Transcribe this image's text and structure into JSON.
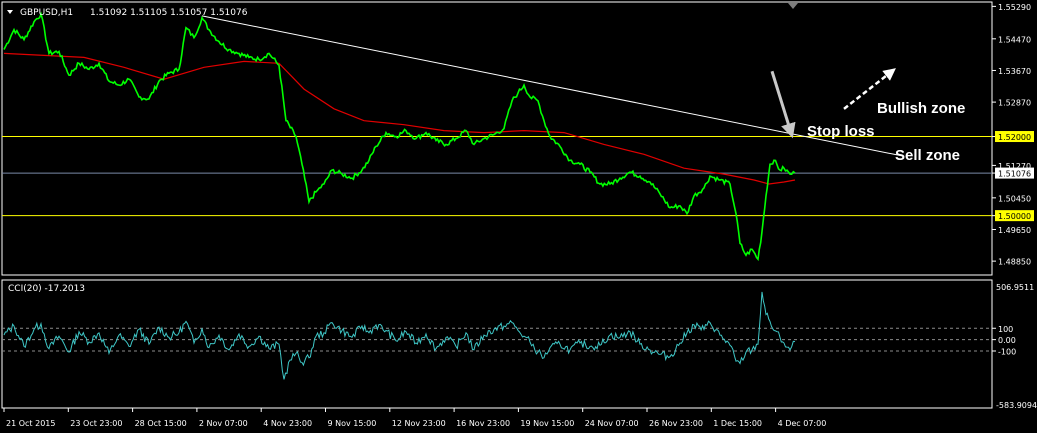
{
  "header": {
    "symbol": "GBPUSD,H1",
    "quote": "1.51092 1.51105 1.51057 1.51076",
    "menu_icon": "triangle-down-icon"
  },
  "cci": {
    "label": "CCI(20) -17.2013",
    "max_label": "506.9511",
    "min_label": "-583.9094",
    "levels": [
      100,
      0,
      -100
    ],
    "level_labels": [
      "100",
      "0.00",
      "-100"
    ],
    "color": "#3fc7c7"
  },
  "annotations": {
    "bullish": "Bullish zone",
    "stop": "Stop loss",
    "sell": "Sell zone"
  },
  "colors": {
    "background": "#000000",
    "price": "#00ff00",
    "ma": "#e00000",
    "yellow_level": "#ffff00",
    "current_line": "#7a8aa8",
    "trendline": "#ffffff",
    "axis": "#ffffff"
  },
  "chart_data": [
    {
      "type": "line",
      "title": "GBPUSD,H1",
      "ylim": [
        1.4855,
        1.5535
      ],
      "y_ticks": [
        "1.55290",
        "1.54470",
        "1.53670",
        "1.52870",
        "1.52000",
        "1.51270",
        "1.51076",
        "1.50450",
        "1.50000",
        "1.49650",
        "1.48850"
      ],
      "horizontal_levels": [
        1.52,
        1.5
      ],
      "current_price": 1.51076,
      "x": [
        "21 Oct 2015",
        "23 Oct 23:00",
        "28 Oct 15:00",
        "2 Nov 07:00",
        "4 Nov 23:00",
        "9 Nov 15:00",
        "12 Nov 23:00",
        "16 Nov 23:00",
        "19 Nov 15:00",
        "24 Nov 07:00",
        "26 Nov 23:00",
        "1 Dec 15:00",
        "4 Dec 07:00"
      ],
      "series": [
        {
          "kind": "price",
          "values": [
            [
              0,
              1.542
            ],
            [
              10,
              1.547
            ],
            [
              20,
              1.5445
            ],
            [
              30,
              1.549
            ],
            [
              37,
              1.551
            ],
            [
              45,
              1.541
            ],
            [
              55,
              1.5415
            ],
            [
              65,
              1.5355
            ],
            [
              75,
              1.5385
            ],
            [
              85,
              1.537
            ],
            [
              95,
              1.5385
            ],
            [
              105,
              1.534
            ],
            [
              115,
              1.533
            ],
            [
              125,
              1.5345
            ],
            [
              135,
              1.53
            ],
            [
              145,
              1.5295
            ],
            [
              155,
              1.534
            ],
            [
              165,
              1.536
            ],
            [
              175,
              1.537
            ],
            [
              182,
              1.5475
            ],
            [
              190,
              1.545
            ],
            [
              198,
              1.55
            ],
            [
              205,
              1.547
            ],
            [
              215,
              1.544
            ],
            [
              225,
              1.542
            ],
            [
              235,
              1.541
            ],
            [
              245,
              1.54
            ],
            [
              255,
              1.5395
            ],
            [
              265,
              1.541
            ],
            [
              275,
              1.538
            ],
            [
              282,
              1.524
            ],
            [
              292,
              1.52
            ],
            [
              298,
              1.513
            ],
            [
              305,
              1.5035
            ],
            [
              312,
              1.506
            ],
            [
              320,
              1.508
            ],
            [
              328,
              1.5115
            ],
            [
              338,
              1.5105
            ],
            [
              348,
              1.5095
            ],
            [
              358,
              1.5115
            ],
            [
              365,
              1.514
            ],
            [
              372,
              1.5175
            ],
            [
              382,
              1.521
            ],
            [
              392,
              1.52
            ],
            [
              402,
              1.5215
            ],
            [
              412,
              1.5195
            ],
            [
              422,
              1.521
            ],
            [
              432,
              1.519
            ],
            [
              442,
              1.518
            ],
            [
              452,
              1.5195
            ],
            [
              462,
              1.5215
            ],
            [
              470,
              1.518
            ],
            [
              480,
              1.5195
            ],
            [
              490,
              1.5205
            ],
            [
              500,
              1.522
            ],
            [
              508,
              1.529
            ],
            [
              514,
              1.531
            ],
            [
              520,
              1.533
            ],
            [
              526,
              1.53
            ],
            [
              534,
              1.529
            ],
            [
              540,
              1.524
            ],
            [
              546,
              1.52
            ],
            [
              556,
              1.5175
            ],
            [
              566,
              1.514
            ],
            [
              576,
              1.513
            ],
            [
              586,
              1.511
            ],
            [
              596,
              1.508
            ],
            [
              606,
              1.508
            ],
            [
              616,
              1.5095
            ],
            [
              626,
              1.511
            ],
            [
              636,
              1.51
            ],
            [
              646,
              1.5085
            ],
            [
              656,
              1.5055
            ],
            [
              666,
              1.502
            ],
            [
              676,
              1.5025
            ],
            [
              683,
              1.5005
            ],
            [
              690,
              1.505
            ],
            [
              700,
              1.507
            ],
            [
              706,
              1.51
            ],
            [
              716,
              1.509
            ],
            [
              726,
              1.508
            ],
            [
              732,
              1.5005
            ],
            [
              736,
              1.493
            ],
            [
              742,
              1.49
            ],
            [
              748,
              1.4915
            ],
            [
              754,
              1.489
            ],
            [
              758,
              1.496
            ],
            [
              762,
              1.505
            ],
            [
              766,
              1.513
            ],
            [
              770,
              1.514
            ],
            [
              776,
              1.5115
            ],
            [
              780,
              1.512
            ],
            [
              786,
              1.5105
            ],
            [
              791,
              1.5108
            ]
          ]
        },
        {
          "kind": "moving-average",
          "values": [
            [
              0,
              1.541
            ],
            [
              40,
              1.5405
            ],
            [
              80,
              1.54
            ],
            [
              120,
              1.5375
            ],
            [
              160,
              1.5345
            ],
            [
              200,
              1.5375
            ],
            [
              240,
              1.539
            ],
            [
              275,
              1.5385
            ],
            [
              300,
              1.532
            ],
            [
              330,
              1.527
            ],
            [
              360,
              1.524
            ],
            [
              400,
              1.523
            ],
            [
              440,
              1.5215
            ],
            [
              480,
              1.521
            ],
            [
              520,
              1.5215
            ],
            [
              560,
              1.521
            ],
            [
              600,
              1.518
            ],
            [
              640,
              1.5155
            ],
            [
              680,
              1.512
            ],
            [
              720,
              1.5105
            ],
            [
              750,
              1.509
            ],
            [
              765,
              1.508
            ],
            [
              780,
              1.5085
            ],
            [
              791,
              1.509
            ]
          ]
        }
      ],
      "trendline": [
        [
          198,
          1.5505
        ],
        [
          900,
          1.515
        ]
      ],
      "arrows": [
        {
          "kind": "stop-arrow",
          "from": [
            768,
            1.5365
          ],
          "to": [
            787,
            1.521
          ]
        },
        {
          "kind": "bullish-arrow",
          "from": [
            840,
            1.527
          ],
          "to": [
            888,
            1.5365
          ]
        }
      ]
    },
    {
      "type": "line",
      "title": "CCI(20)",
      "ylim": [
        -583.9094,
        506.9511
      ],
      "levels": [
        100,
        0,
        -100
      ],
      "series": [
        {
          "kind": "cci",
          "values": [
            [
              0,
              40
            ],
            [
              10,
              120
            ],
            [
              20,
              -60
            ],
            [
              30,
              90
            ],
            [
              37,
              140
            ],
            [
              45,
              -80
            ],
            [
              55,
              30
            ],
            [
              65,
              -110
            ],
            [
              75,
              70
            ],
            [
              85,
              -20
            ],
            [
              95,
              60
            ],
            [
              105,
              -120
            ],
            [
              115,
              40
            ],
            [
              125,
              -60
            ],
            [
              135,
              90
            ],
            [
              145,
              -40
            ],
            [
              155,
              110
            ],
            [
              165,
              20
            ],
            [
              175,
              60
            ],
            [
              182,
              160
            ],
            [
              190,
              -30
            ],
            [
              198,
              100
            ],
            [
              205,
              -70
            ],
            [
              215,
              40
            ],
            [
              225,
              -90
            ],
            [
              235,
              50
            ],
            [
              245,
              -60
            ],
            [
              255,
              30
            ],
            [
              265,
              -80
            ],
            [
              275,
              -40
            ],
            [
              280,
              -350
            ],
            [
              286,
              -180
            ],
            [
              292,
              -120
            ],
            [
              298,
              -200
            ],
            [
              305,
              -160
            ],
            [
              312,
              30
            ],
            [
              320,
              60
            ],
            [
              328,
              150
            ],
            [
              338,
              80
            ],
            [
              348,
              20
            ],
            [
              358,
              120
            ],
            [
              365,
              60
            ],
            [
              372,
              130
            ],
            [
              382,
              80
            ],
            [
              392,
              -10
            ],
            [
              402,
              70
            ],
            [
              412,
              -30
            ],
            [
              422,
              50
            ],
            [
              432,
              -80
            ],
            [
              442,
              20
            ],
            [
              452,
              -60
            ],
            [
              462,
              60
            ],
            [
              470,
              -90
            ],
            [
              480,
              40
            ],
            [
              490,
              90
            ],
            [
              500,
              120
            ],
            [
              508,
              150
            ],
            [
              514,
              80
            ],
            [
              520,
              30
            ],
            [
              526,
              -20
            ],
            [
              534,
              -110
            ],
            [
              540,
              -160
            ],
            [
              546,
              -70
            ],
            [
              556,
              -40
            ],
            [
              566,
              -90
            ],
            [
              576,
              -30
            ],
            [
              586,
              -60
            ],
            [
              596,
              -50
            ],
            [
              606,
              40
            ],
            [
              616,
              20
            ],
            [
              626,
              70
            ],
            [
              636,
              -40
            ],
            [
              646,
              -90
            ],
            [
              656,
              -130
            ],
            [
              666,
              -150
            ],
            [
              676,
              -30
            ],
            [
              683,
              60
            ],
            [
              690,
              130
            ],
            [
              700,
              90
            ],
            [
              706,
              150
            ],
            [
              716,
              40
            ],
            [
              726,
              -50
            ],
            [
              732,
              -190
            ],
            [
              736,
              -210
            ],
            [
              742,
              -110
            ],
            [
              748,
              -90
            ],
            [
              754,
              -40
            ],
            [
              758,
              420
            ],
            [
              762,
              220
            ],
            [
              766,
              160
            ],
            [
              770,
              80
            ],
            [
              776,
              20
            ],
            [
              780,
              -30
            ],
            [
              786,
              -90
            ],
            [
              791,
              -17
            ]
          ]
        }
      ]
    }
  ]
}
